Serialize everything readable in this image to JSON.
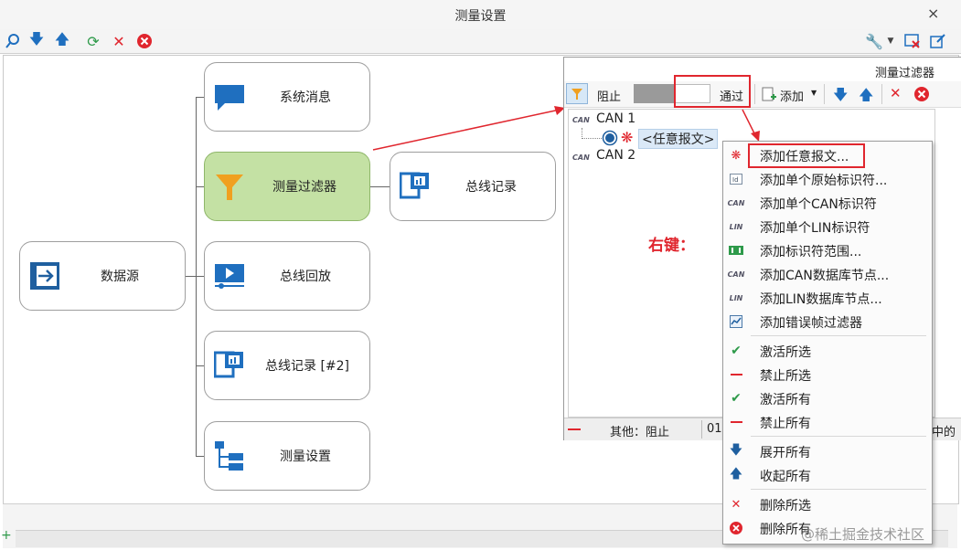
{
  "window": {
    "title": "测量设置",
    "close": "×"
  },
  "nodes": {
    "source": "数据源",
    "system_msg": "系统消息",
    "filter": "测量过滤器",
    "bus_log": "总线记录",
    "replay": "总线回放",
    "bus_log2": "总线记录 [#2]",
    "settings": "测量设置"
  },
  "filter_window": {
    "title": "测量过滤器",
    "block_label": "阻止",
    "pass_label": "通过",
    "add_label": "添加",
    "tree": {
      "can1": "CAN 1",
      "any_msg": "<任意报文>",
      "can2": "CAN 2",
      "can_tag": "CAN"
    },
    "status_other": "其他：阻止",
    "status_num": "01",
    "status_tail": "中的"
  },
  "annotation": {
    "right_click": "右键："
  },
  "context_menu": {
    "items": [
      {
        "label": "添加任意报文...",
        "icon": "asterisk-icon"
      },
      {
        "label": "添加单个原始标识符...",
        "icon": "id-icon"
      },
      {
        "label": "添加单个CAN标识符",
        "icon": "can-icon"
      },
      {
        "label": "添加单个LIN标识符",
        "icon": "lin-icon"
      },
      {
        "label": "添加标识符范围...",
        "icon": "range-icon"
      },
      {
        "label": "添加CAN数据库节点...",
        "icon": "can-node-icon"
      },
      {
        "label": "添加LIN数据库节点...",
        "icon": "lin-node-icon"
      },
      {
        "label": "添加错误帧过滤器",
        "icon": "error-frame-icon"
      },
      {
        "label": "激活所选",
        "icon": "check-icon"
      },
      {
        "label": "禁止所选",
        "icon": "minus-icon"
      },
      {
        "label": "激活所有",
        "icon": "check-icon"
      },
      {
        "label": "禁止所有",
        "icon": "minus-icon"
      },
      {
        "label": "展开所有",
        "icon": "arrow-down-icon"
      },
      {
        "label": "收起所有",
        "icon": "arrow-up-icon"
      },
      {
        "label": "删除所选",
        "icon": "x-icon"
      },
      {
        "label": "删除所有",
        "icon": "delete-circle-icon"
      }
    ]
  },
  "watermark": "@稀土掘金技术社区",
  "colors": {
    "accent_blue": "#1f6fbf",
    "red": "#e0262e",
    "green_node": "#c4e1a4",
    "orange": "#f0a020"
  }
}
